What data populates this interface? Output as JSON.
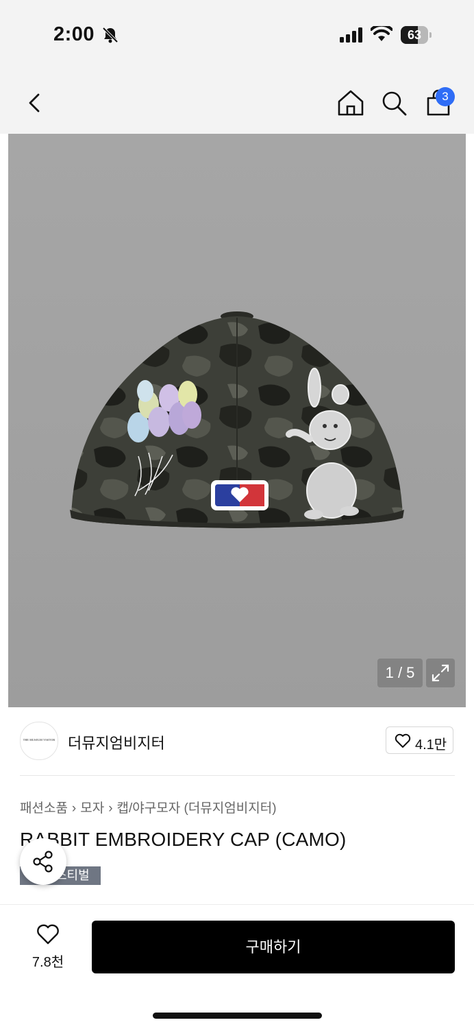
{
  "status_bar": {
    "time": "2:00",
    "battery": "63",
    "battery_level": 0.63,
    "icons": [
      "bell-slash-icon",
      "signal-icon",
      "wifi-icon",
      "battery-icon"
    ]
  },
  "nav": {
    "icons": [
      "back-icon",
      "home-icon",
      "search-icon",
      "shopping-bag-icon"
    ],
    "cart_badge": "3"
  },
  "gallery": {
    "page_counter": "1 / 5",
    "current_page": 1,
    "total_pages": 5,
    "icons": [
      "expand-icon"
    ]
  },
  "brand": {
    "logo_text": "THE MUSEUM VISITOR",
    "name": "더뮤지엄비지터",
    "likes": "4.1만"
  },
  "product": {
    "breadcrumb": [
      "패션소품",
      "모자",
      "캡/야구모자 (더뮤지엄비지터)"
    ],
    "title": "RABBIT EMBROIDERY CAP (CAMO)",
    "tag": "스티벌"
  },
  "bottom_bar": {
    "wish_count": "7.8천",
    "buy_label": "구매하기"
  },
  "colors": {
    "badge": "#2f6df6",
    "buy_button": "#000000",
    "tag_bg": "#6f7683"
  }
}
